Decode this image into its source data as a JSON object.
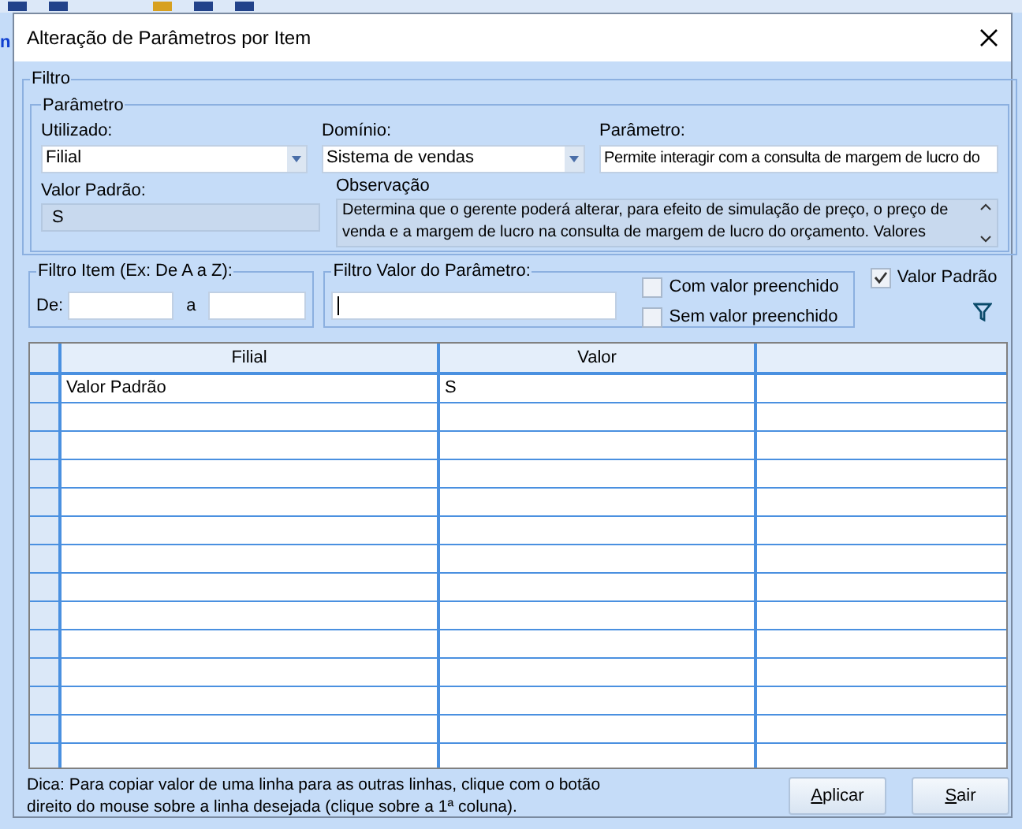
{
  "background": {
    "fragment": "n"
  },
  "dialog": {
    "title": "Alteração de Parâmetros por Item",
    "filtro": {
      "legend": "Filtro",
      "parametro": {
        "legend": "Parâmetro",
        "utilizado": {
          "label": "Utilizado:",
          "value": "Filial"
        },
        "dominio": {
          "label": "Domínio:",
          "value": "Sistema de vendas"
        },
        "parametro": {
          "label": "Parâmetro:",
          "value": "Permite interagir com a consulta de margem de lucro do"
        },
        "valor_padrao": {
          "label": "Valor Padrão:",
          "value": "S"
        },
        "observacao": {
          "label": "Observação",
          "value": "Determina que o gerente poderá alterar, para efeito de simulação de preço, o preço de venda e a margem de lucro na consulta de margem de lucro do orçamento. Valores"
        }
      },
      "filtro_item": {
        "legend": "Filtro Item (Ex: De A a Z):",
        "de_label": "De:",
        "a_label": "a"
      },
      "filtro_valor": {
        "legend": "Filtro Valor do Parâmetro:",
        "checkboxes": [
          {
            "label": "Com valor preenchido",
            "checked": false
          },
          {
            "label": "Sem valor preenchido",
            "checked": false
          }
        ]
      },
      "valor_padrao_check": {
        "label": "Valor Padrão",
        "checked": true
      }
    },
    "table": {
      "columns": [
        "Filial",
        "Valor"
      ],
      "rows": [
        {
          "cells": [
            "Valor Padrão",
            "S"
          ]
        }
      ]
    },
    "hint": "Dica: Para copiar valor de uma linha para as outras linhas, clique com o botão direito do mouse sobre a linha desejada (clique sobre a 1ª coluna).",
    "buttons": [
      {
        "label": "Aplicar",
        "underline_first": true
      },
      {
        "label": "Sair",
        "underline_first": true
      }
    ]
  }
}
